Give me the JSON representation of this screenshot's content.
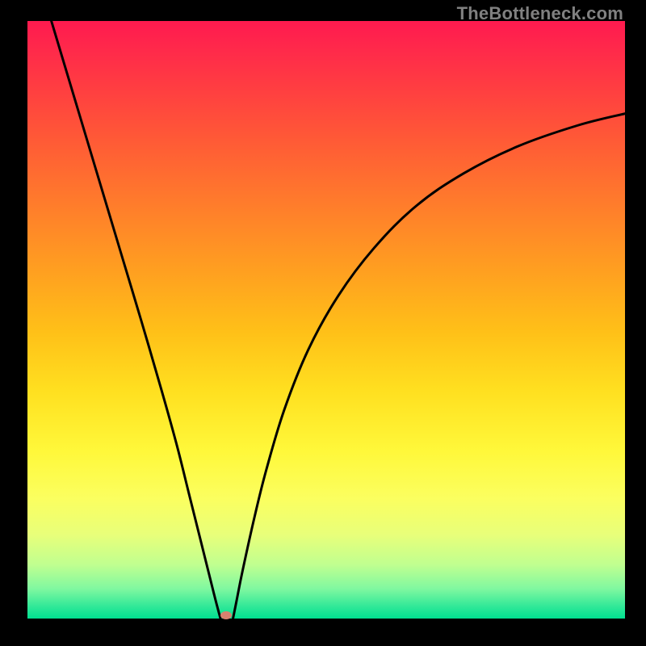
{
  "watermark": "TheBottleneck.com",
  "chart_data": {
    "type": "line",
    "title": "",
    "xlabel": "",
    "ylabel": "",
    "xlim": [
      0,
      100
    ],
    "ylim": [
      0,
      100
    ],
    "grid": false,
    "legend": false,
    "background_gradient": {
      "direction": "vertical",
      "stops": [
        {
          "pos": 0,
          "color": "#ff1a4f"
        },
        {
          "pos": 30,
          "color": "#ff7a2c"
        },
        {
          "pos": 60,
          "color": "#ffe020"
        },
        {
          "pos": 85,
          "color": "#e8ff7a"
        },
        {
          "pos": 100,
          "color": "#00e090"
        }
      ]
    },
    "series": [
      {
        "name": "left-branch",
        "x": [
          4,
          7,
          10,
          13,
          16,
          19,
          22.5,
          25,
          27,
          29,
          30.5,
          31.5,
          32.3
        ],
        "values": [
          100,
          90,
          80,
          70,
          60,
          50,
          38,
          29,
          21,
          13,
          7,
          3,
          0
        ]
      },
      {
        "name": "right-branch",
        "x": [
          34.4,
          35,
          36,
          38,
          40,
          43,
          47,
          52,
          58,
          65,
          73,
          82,
          92,
          100
        ],
        "values": [
          0,
          3,
          8,
          17,
          25,
          35,
          45,
          54,
          62,
          69,
          74.5,
          79,
          82.5,
          84.5
        ]
      }
    ],
    "marker": {
      "x": 33.2,
      "y": 0.5,
      "color": "#d8816f"
    },
    "colors": {
      "curve": "#000000"
    }
  }
}
